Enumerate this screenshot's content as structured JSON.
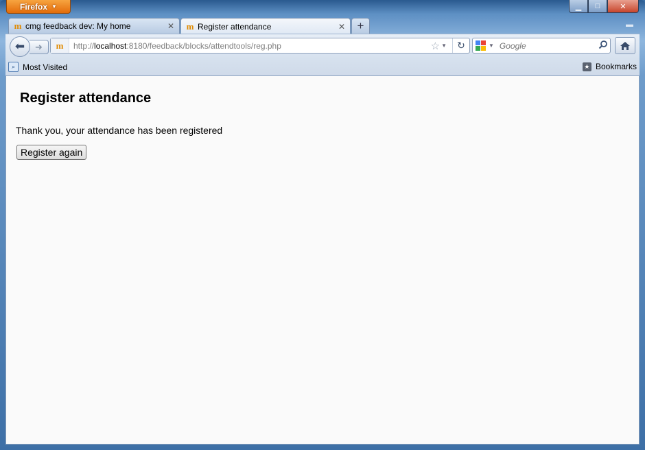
{
  "browser": {
    "menu_button": "Firefox",
    "window_controls": {
      "minimize": "▁",
      "maximize": "□",
      "close": "✕"
    }
  },
  "tabs": [
    {
      "label": "cmg feedback dev: My home",
      "favicon": "moodle-icon",
      "active": false
    },
    {
      "label": "Register attendance",
      "favicon": "moodle-icon",
      "active": true
    }
  ],
  "navbar": {
    "url_scheme": "http://",
    "url_host": "localhost",
    "url_rest": ":8180/feedback/blocks/attendtools/reg.php",
    "search_placeholder": "Google"
  },
  "bookmarks_bar": {
    "most_visited": "Most Visited",
    "bookmarks": "Bookmarks"
  },
  "page": {
    "title": "Register attendance",
    "message": "Thank you, your attendance has been registered",
    "button": "Register again"
  },
  "colors": {
    "firefox_orange": "#e36c0a",
    "moodle_orange": "#e08a00",
    "page_background": "#fafafa"
  }
}
